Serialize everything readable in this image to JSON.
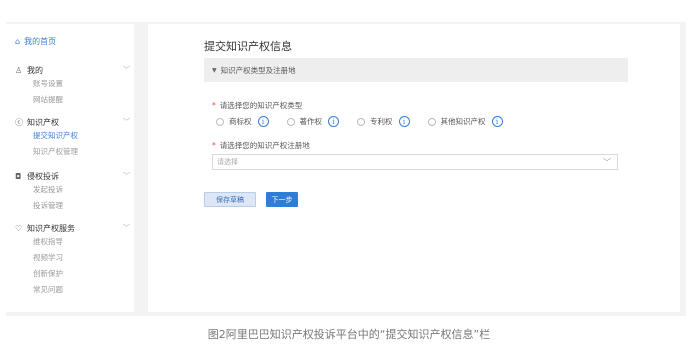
{
  "sidebar": {
    "home": {
      "icon": "home-icon",
      "label": "我的首页"
    },
    "groups": [
      {
        "icon": "user-icon",
        "label": "我的",
        "items": [
          "账号设置",
          "网站提醒"
        ]
      },
      {
        "icon": "copyright-icon",
        "label": "知识产权",
        "items": [
          "提交知识产权",
          "知识产权管理"
        ],
        "active_item": "提交知识产权"
      },
      {
        "icon": "camera-icon",
        "label": "侵权投诉",
        "items": [
          "发起投诉",
          "投诉管理"
        ]
      },
      {
        "icon": "heart-icon",
        "label": "知识产权服务",
        "items": [
          "维权指导",
          "视频学习",
          "创新保护",
          "常见问题"
        ]
      }
    ]
  },
  "main": {
    "title": "提交知识产权信息",
    "section_label": "知识产权类型及注册地",
    "type_question": "请选择您的知识产权类型",
    "type_options": [
      "商标权",
      "著作权",
      "专利权",
      "其他知识产权"
    ],
    "region_question": "请选择您的知识产权注册地",
    "region_placeholder": "请选择",
    "save_draft_label": "保存草稿",
    "next_label": "下一步"
  },
  "caption": "图2阿里巴巴知识产权投诉平台中的“提交知识产权信息”栏",
  "colors": {
    "accent": "#2e7ed8",
    "link": "#3b7ed1",
    "required": "#e5483b"
  }
}
